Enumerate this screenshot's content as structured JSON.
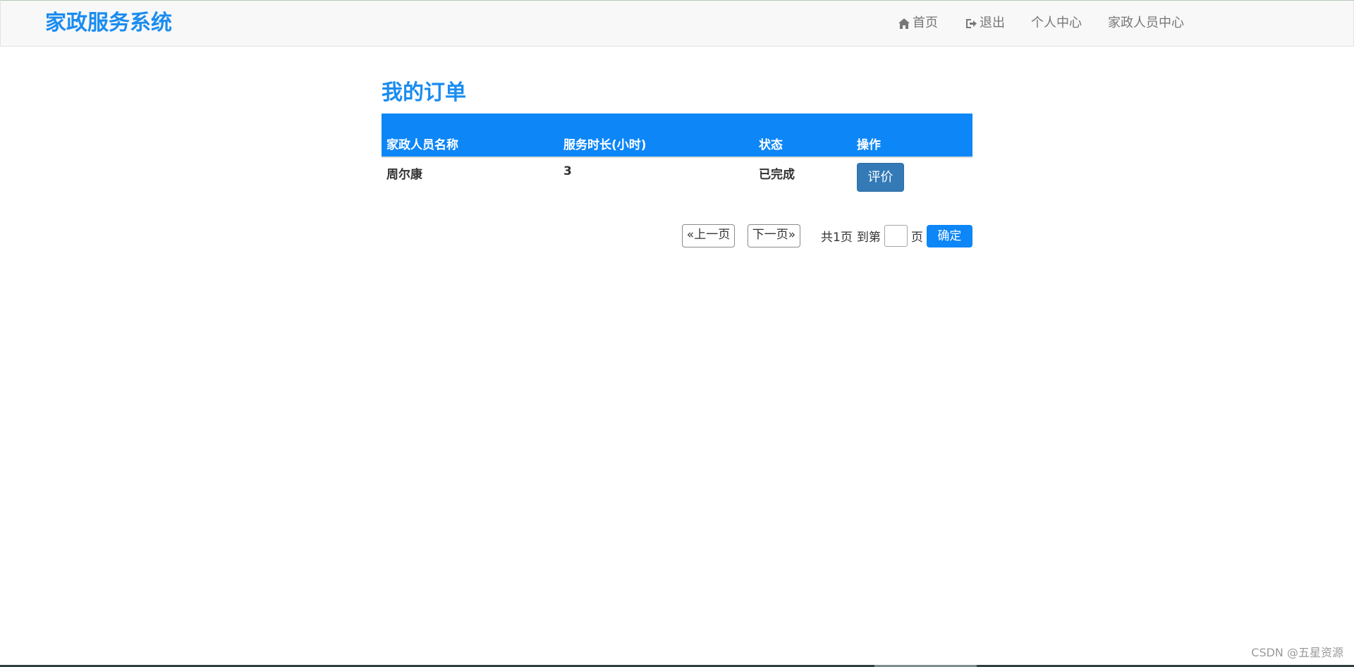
{
  "navbar": {
    "brand": "家政服务系统",
    "items": [
      {
        "label": "首页",
        "icon": "home-icon"
      },
      {
        "label": "退出",
        "icon": "sign-out-icon"
      },
      {
        "label": "个人中心"
      },
      {
        "label": "家政人员中心"
      }
    ]
  },
  "main": {
    "title": "我的订单",
    "table": {
      "headers": [
        "家政人员名称",
        "服务时长(小时)",
        "状态",
        "操作"
      ],
      "rows": [
        {
          "name": "周尔康",
          "hours": "3",
          "status": "已完成",
          "action": "评价"
        }
      ]
    },
    "pager": {
      "prev": "«上一页",
      "next": "下一页»",
      "total": "共1页",
      "goto": "到第",
      "input_value": "",
      "unit": "页",
      "confirm": "确定"
    }
  },
  "watermark": "CSDN @五星资源",
  "colors": {
    "accent": "#0d86f7",
    "brand_text": "#1a8cf0",
    "rate_button": "#337ab7"
  }
}
